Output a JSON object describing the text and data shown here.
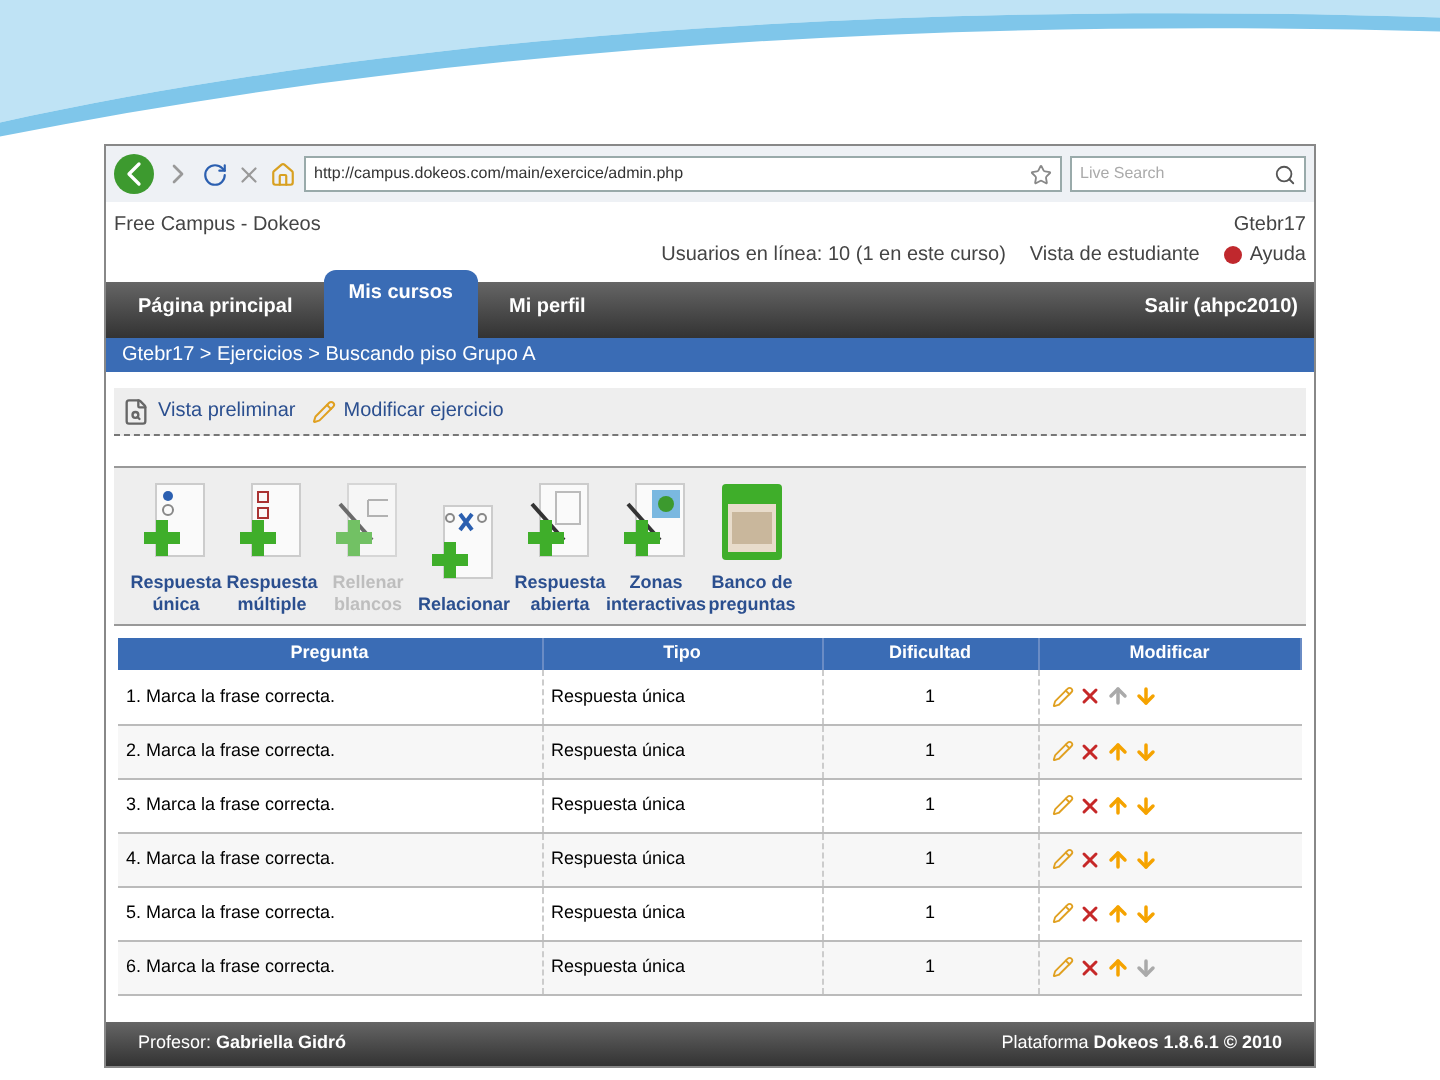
{
  "browser": {
    "url": "http://campus.dokeos.com/main/exercice/admin.php",
    "search_placeholder": "Live Search"
  },
  "header": {
    "site": "Free Campus - Dokeos",
    "course": "Gtebr17",
    "online": "Usuarios en línea: 10 (1 en este curso)",
    "student_view": "Vista de estudiante",
    "help": "Ayuda"
  },
  "nav": [
    {
      "label": "Página principal",
      "selected": false
    },
    {
      "label": "Mis cursos",
      "selected": true
    },
    {
      "label": "Mi perfil",
      "selected": false
    }
  ],
  "logout": "Salir (ahpc2010)",
  "breadcrumb": "Gtebr17 > Ejercicios > Buscando piso Grupo A",
  "actions": [
    {
      "label": "Vista preliminar",
      "kind": "preview"
    },
    {
      "label": "Modificar ejercicio",
      "kind": "edit"
    }
  ],
  "tools": [
    {
      "label": "Respuesta única",
      "kind": "single",
      "disabled": false
    },
    {
      "label": "Respuesta múltiple",
      "kind": "multiple",
      "disabled": false
    },
    {
      "label": "Rellenar blancos",
      "kind": "fill",
      "disabled": true
    },
    {
      "label": "Relacionar",
      "kind": "match",
      "disabled": false
    },
    {
      "label": "Respuesta abierta",
      "kind": "open",
      "disabled": false
    },
    {
      "label": "Zonas interactivas",
      "kind": "hotspot",
      "disabled": false
    },
    {
      "label": "Banco de preguntas",
      "kind": "bank",
      "disabled": false
    }
  ],
  "table": {
    "columns": [
      "Pregunta",
      "Tipo",
      "Dificultad",
      "Modificar"
    ],
    "rows": [
      {
        "question": "1. Marca la frase correcta.",
        "type": "Respuesta única",
        "difficulty": "1",
        "can_up": false,
        "can_down": true
      },
      {
        "question": "2. Marca la frase correcta.",
        "type": "Respuesta única",
        "difficulty": "1",
        "can_up": true,
        "can_down": true
      },
      {
        "question": "3. Marca la frase correcta.",
        "type": "Respuesta única",
        "difficulty": "1",
        "can_up": true,
        "can_down": true
      },
      {
        "question": "4. Marca la frase correcta.",
        "type": "Respuesta única",
        "difficulty": "1",
        "can_up": true,
        "can_down": true
      },
      {
        "question": "5. Marca la frase correcta.",
        "type": "Respuesta única",
        "difficulty": "1",
        "can_up": true,
        "can_down": true
      },
      {
        "question": "6. Marca la frase correcta.",
        "type": "Respuesta única",
        "difficulty": "1",
        "can_up": true,
        "can_down": false
      }
    ]
  },
  "footer": {
    "teacher_label": "Profesor:",
    "teacher": "Gabriella Gidró",
    "platform_label": "Plataforma",
    "platform": "Dokeos 1.8.6.1 © 2010"
  }
}
